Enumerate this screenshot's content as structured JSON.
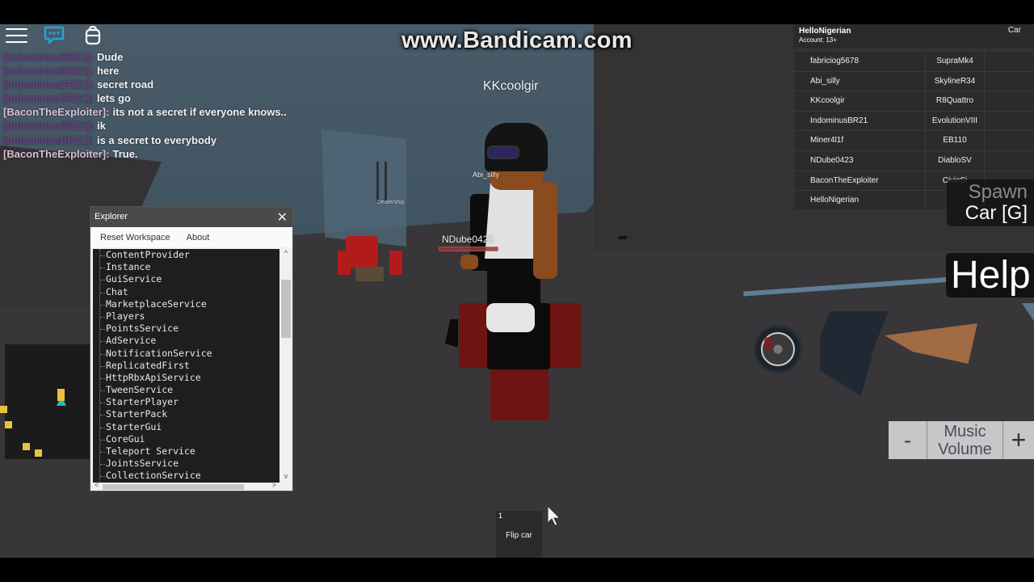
{
  "watermark": "www.Bandicam.com",
  "topbar": {
    "menu_icon": "hamburger-menu-icon",
    "chat_icon": "chat-bubble-icon",
    "backpack_icon": "backpack-icon"
  },
  "chat": {
    "messages": [
      {
        "speaker": "[IndominusBR21]:",
        "text": "Dude",
        "speaker_color": "#6a3f84"
      },
      {
        "speaker": "[IndominusBR21]:",
        "text": "here",
        "speaker_color": "#6a3f84"
      },
      {
        "speaker": "[IndominusBR21]:",
        "text": "secret road",
        "speaker_color": "#6a3f84"
      },
      {
        "speaker": "[IndominusBR21]:",
        "text": "lets go",
        "speaker_color": "#6a3f84"
      },
      {
        "speaker": "[BaconTheExploiter]:",
        "text": "its not a secret if everyone knows..",
        "speaker_color": "#d9bfd6"
      },
      {
        "speaker": "[IndominusBR21]:",
        "text": "ik",
        "speaker_color": "#6a3f84"
      },
      {
        "speaker": "[IndominusBR21]:",
        "text": "is a secret to everybody",
        "speaker_color": "#6a3f84"
      },
      {
        "speaker": "[BaconTheExploiter]:",
        "text": "True.",
        "speaker_color": "#d9bfd6"
      }
    ]
  },
  "nametags": {
    "kk": "KKcoolgir",
    "abi": "Abi_silly",
    "dealership": "Dealership",
    "ndube": "NDube0423"
  },
  "health": {
    "ndube_fraction": 1.0,
    "color": "#8c3a3a"
  },
  "playerlist": {
    "local_player": "HelloNigerian",
    "account": "Account: 13+",
    "stat_header": "Car",
    "players": [
      {
        "name": "fabriciog5678",
        "car": "SupraMk4"
      },
      {
        "name": "Abi_silly",
        "car": "SkylineR34"
      },
      {
        "name": "KKcoolgir",
        "car": "R8Quattro"
      },
      {
        "name": "IndominusBR21",
        "car": "EvolutionVIII"
      },
      {
        "name": "Miner4l1f",
        "car": "EB110"
      },
      {
        "name": "NDube0423",
        "car": "DiabloSV"
      },
      {
        "name": "BaconTheExploiter",
        "car": "CivicSi"
      },
      {
        "name": "HelloNigerian",
        "car": ""
      }
    ]
  },
  "spawn_button": {
    "line1": "Spawn",
    "line2": "Car [G]"
  },
  "help_button": {
    "label": "Help"
  },
  "music": {
    "minus": "-",
    "label_line1": "Music",
    "label_line2": "Volume",
    "plus": "+"
  },
  "explorer": {
    "title": "Explorer",
    "close": "✕",
    "menu": [
      "Reset Workspace",
      "About"
    ],
    "items": [
      "ContentProvider",
      "Instance",
      "GuiService",
      "Chat",
      "MarketplaceService",
      "Players",
      "PointsService",
      "AdService",
      "NotificationService",
      "ReplicatedFirst",
      "HttpRbxApiService",
      "TweenService",
      "StarterPlayer",
      "StarterPack",
      "StarterGui",
      "CoreGui",
      "Teleport Service",
      "JointsService",
      "CollectionService"
    ],
    "scroll_up": "^",
    "scroll_down": "v",
    "scroll_left": "<",
    "scroll_right": ">"
  },
  "hotbar": [
    {
      "slot": "1",
      "label": "Flip car"
    }
  ],
  "colors": {
    "minimap_dot": "#e8c33a",
    "minimap_player": "#29b6c9",
    "chat_accent": "#2a9fd6"
  }
}
